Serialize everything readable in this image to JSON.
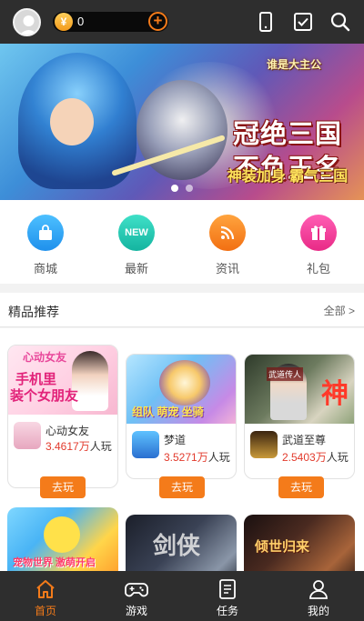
{
  "header": {
    "coin_balance": "0",
    "coin_symbol": "¥",
    "add_symbol": "+",
    "icons": [
      "avatar-icon",
      "phone-icon",
      "task-checkbox-icon",
      "search-icon"
    ]
  },
  "banner": {
    "subtitle": "谁是大主公",
    "title_line1": "冠绝三国",
    "title_line2": "不负王名",
    "slogan": "神装加身 霸气三国",
    "slide_count": 2,
    "active_slide": 1
  },
  "quick_nav": [
    {
      "label": "商城",
      "icon": "bag-icon",
      "color": "#2fa8f5"
    },
    {
      "label": "最新",
      "icon": "new-badge-icon",
      "badge_text": "NEW",
      "color": "#24c8b4"
    },
    {
      "label": "资讯",
      "icon": "rss-icon",
      "color": "#f6841c"
    },
    {
      "label": "礼包",
      "icon": "gift-icon",
      "color": "#f43a9a"
    }
  ],
  "section": {
    "title": "精品推荐",
    "more": "全部 >"
  },
  "games": [
    {
      "name": "心动女友",
      "count": "3.4617万",
      "suffix": "人玩",
      "button": "去玩",
      "image_text_1": "心动女友",
      "image_text_2": "手机里",
      "image_text_3": "装个女朋友"
    },
    {
      "name": "梦道",
      "count": "3.5271万",
      "suffix": "人玩",
      "button": "去玩",
      "image_text_1": "组队 萌宠 坐骑"
    },
    {
      "name": "武道至尊",
      "count": "2.5403万",
      "suffix": "人玩",
      "button": "去玩",
      "image_text_1": "武道传人",
      "image_text_2": "神"
    }
  ],
  "games_row2": [
    {
      "image_text": "宠物世界 激萌开启"
    },
    {
      "image_text": "剑侠"
    },
    {
      "image_text": "倾世归来"
    }
  ],
  "tabbar": [
    {
      "label": "首页",
      "icon": "home-icon",
      "active": true
    },
    {
      "label": "游戏",
      "icon": "gamepad-icon",
      "active": false
    },
    {
      "label": "任务",
      "icon": "task-list-icon",
      "active": false
    },
    {
      "label": "我的",
      "icon": "user-icon",
      "active": false
    }
  ],
  "colors": {
    "accent": "#f47b1a",
    "bar_background": "#2e2e2e",
    "count_red": "#e23a2c"
  }
}
